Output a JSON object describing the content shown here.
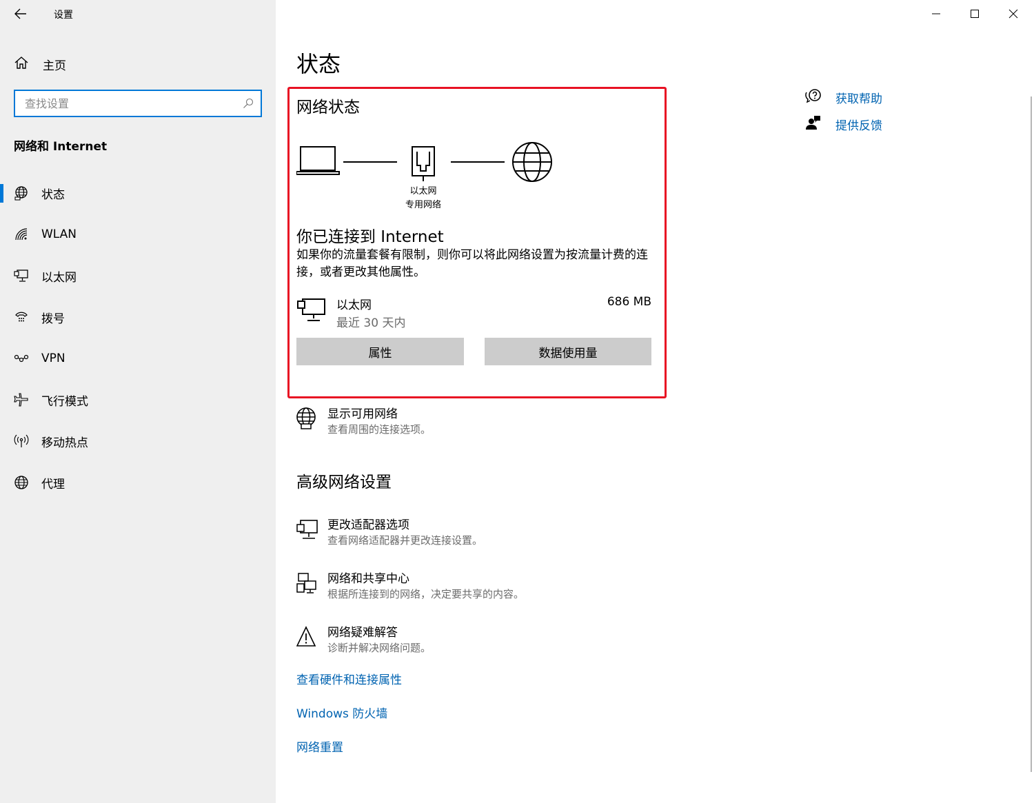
{
  "app": {
    "title": "设置"
  },
  "sidebar": {
    "home_label": "主页",
    "search_placeholder": "查找设置",
    "section_title": "网络和 Internet",
    "items": [
      {
        "label": "状态",
        "icon": "globe-status-icon",
        "active": true
      },
      {
        "label": "WLAN",
        "icon": "wifi-icon"
      },
      {
        "label": "以太网",
        "icon": "ethernet-icon"
      },
      {
        "label": "拨号",
        "icon": "dialup-icon"
      },
      {
        "label": "VPN",
        "icon": "vpn-icon"
      },
      {
        "label": "飞行模式",
        "icon": "airplane-icon"
      },
      {
        "label": "移动热点",
        "icon": "hotspot-icon"
      },
      {
        "label": "代理",
        "icon": "globe-icon"
      }
    ]
  },
  "main": {
    "page_title": "状态",
    "network_status": {
      "title": "网络状态",
      "adapter_label": "以太网",
      "network_type": "专用网络",
      "connected_title": "你已连接到 Internet",
      "description": "如果你的流量套餐有限制，则你可以将此网络设置为按流量计费的连接，或者更改其他属性。",
      "adapter": {
        "name": "以太网",
        "period": "最近 30 天内",
        "usage": "686 MB"
      },
      "properties_button": "属性",
      "data_usage_button": "数据使用量"
    },
    "show_networks": {
      "title": "显示可用网络",
      "subtitle": "查看周围的连接选项。"
    },
    "advanced": {
      "title": "高级网络设置",
      "options": [
        {
          "title": "更改适配器选项",
          "subtitle": "查看网络适配器并更改连接设置。"
        },
        {
          "title": "网络和共享中心",
          "subtitle": "根据所连接到的网络，决定要共享的内容。"
        },
        {
          "title": "网络疑难解答",
          "subtitle": "诊断并解决网络问题。"
        }
      ],
      "links": [
        "查看硬件和连接属性",
        "Windows 防火墙",
        "网络重置"
      ]
    }
  },
  "help": {
    "get_help": "获取帮助",
    "feedback": "提供反馈"
  },
  "colors": {
    "accent": "#0078d7",
    "link": "#0063b1",
    "highlight": "#e81123"
  }
}
